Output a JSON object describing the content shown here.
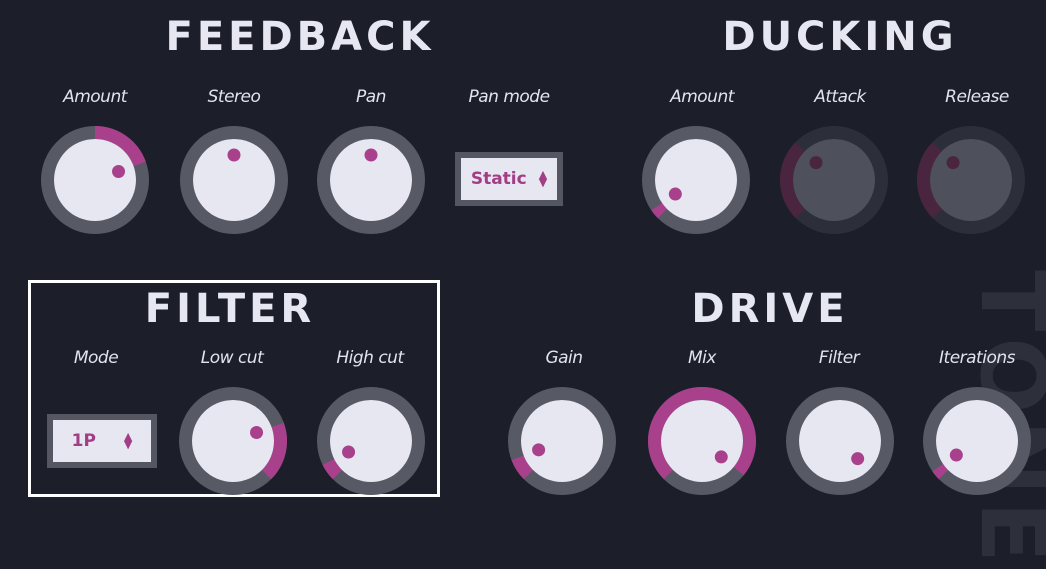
{
  "colors": {
    "accent": "#a8408c",
    "ring": "#575964",
    "face": "#e6e7f1",
    "background": "#1c1e2a",
    "disabled_face": "#4e505b",
    "disabled_ring": "#2c2e3a",
    "disabled_accent": "#4a2540"
  },
  "watermark": "TONE",
  "feedback": {
    "title": "FEEDBACK",
    "amount": {
      "label": "Amount",
      "value": 0.76,
      "fill": "center"
    },
    "stereo": {
      "label": "Stereo",
      "value": 0.5,
      "fill": "center"
    },
    "pan": {
      "label": "Pan",
      "value": 0.5,
      "fill": "center"
    },
    "pan_mode": {
      "label": "Pan mode",
      "selected": "Static"
    }
  },
  "ducking": {
    "title": "DUCKING",
    "amount": {
      "label": "Amount",
      "value": 0.04,
      "fill": "min",
      "enabled": true
    },
    "attack": {
      "label": "Attack",
      "value": 0.33,
      "fill": "min",
      "enabled": false
    },
    "release": {
      "label": "Release",
      "value": 0.33,
      "fill": "min",
      "enabled": false
    }
  },
  "filter": {
    "title": "FILTER",
    "mode": {
      "label": "Mode",
      "selected": "1P"
    },
    "low_cut": {
      "label": "Low cut",
      "value": 0.76,
      "fill": "max"
    },
    "high_cut": {
      "label": "High cut",
      "value": 0.07,
      "fill": "min"
    }
  },
  "drive": {
    "title": "DRIVE",
    "gain": {
      "label": "Gain",
      "value": 0.09,
      "fill": "min"
    },
    "mix": {
      "label": "Mix",
      "value": 0.98,
      "fill": "min"
    },
    "filter": {
      "label": "Filter",
      "value": 1.0,
      "fill": "max"
    },
    "iterations": {
      "label": "Iterations",
      "value": 0.04,
      "fill": "min"
    }
  },
  "icons": {
    "select_arrows": "▲▼"
  }
}
